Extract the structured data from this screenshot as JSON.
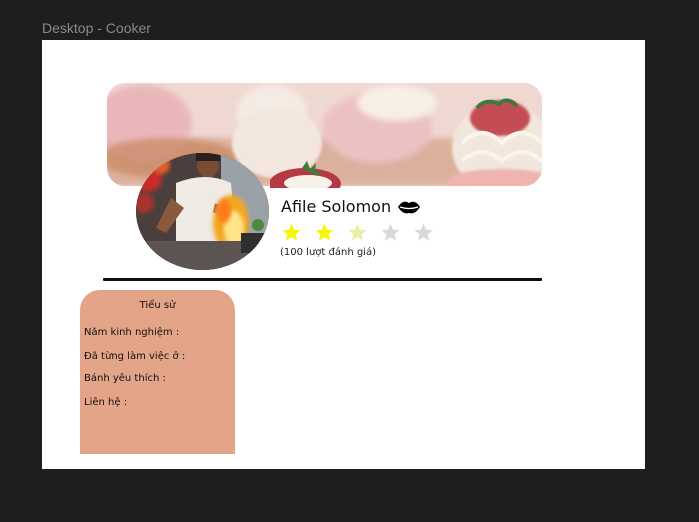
{
  "frame": {
    "label": "Desktop - Cooker"
  },
  "profile": {
    "name": "Afile Solomon",
    "rating": 2.5,
    "rating_max": 5,
    "review_count_text": "(100 lượt đánh giá)"
  },
  "bio": {
    "title": "Tiểu sử",
    "experience_label": "Năm kinh nghiệm :",
    "worked_at_label": "Đã từng làm việc ở :",
    "favorite_cake_label": "Bánh yêu thích :",
    "contact_label": "Liên hệ :"
  },
  "colors": {
    "background": "#1e1e1e",
    "canvas": "#ffffff",
    "bio_card": "#e3a488",
    "star_filled": "#f5f50a",
    "star_empty": "#d9d9d9",
    "divider": "#0f0f0f"
  },
  "icons": {
    "lips": "lips-icon",
    "star": "star-icon"
  }
}
